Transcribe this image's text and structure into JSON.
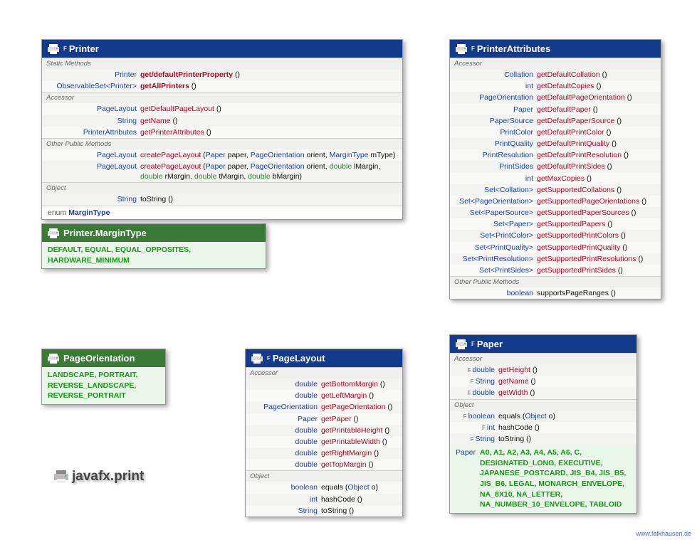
{
  "package": "javafx.print",
  "credit": "www.falkhausen.de",
  "printer": {
    "title": "Printer",
    "sup": "F",
    "sections": [
      {
        "label": "Static Methods",
        "rows": [
          {
            "ret": "Printer",
            "name": "get/defaultPrinterProperty",
            "bold": true,
            "sig": " ()"
          },
          {
            "ret": "ObservableSet<Printer>",
            "name": "getAllPrinters",
            "bold": true,
            "sig": " ()"
          }
        ]
      },
      {
        "label": "Accessor",
        "rows": [
          {
            "ret": "PageLayout",
            "name": "getDefaultPageLayout",
            "sig": " ()"
          },
          {
            "ret": "String",
            "name": "getName",
            "sig": " ()"
          },
          {
            "ret": "PrinterAttributes",
            "name": "getPrinterAttributes",
            "sig": " ()"
          }
        ]
      },
      {
        "label": "Other Public Methods",
        "rows": [
          {
            "ret": "PageLayout",
            "name": "createPageLayout",
            "sigHtml": " (<span class='t'>Paper</span> paper, <span class='t'>PageOrientation</span> orient, <span class='t'>MarginType</span> mType)"
          },
          {
            "ret": "PageLayout",
            "name": "createPageLayout",
            "sigHtml": " (<span class='t'>Paper</span> paper, <span class='t'>PageOrientation</span> orient, <span class='k'>double</span> lMargin,<br><span class='k'>double</span> rMargin, <span class='k'>double</span> tMargin, <span class='k'>double</span> bMargin)"
          }
        ]
      },
      {
        "label": "Object",
        "rows": [
          {
            "ret": "String",
            "name": "toString",
            "black": true,
            "sig": " ()"
          }
        ]
      }
    ],
    "enumFooter": {
      "kw": "enum",
      "name": "MarginType"
    }
  },
  "marginType": {
    "title": "Printer.MarginType",
    "values": "DEFAULT, EQUAL, EQUAL_OPPOSITES, HARDWARE_MINIMUM"
  },
  "printerAttr": {
    "title": "PrinterAttributes",
    "sup": "F",
    "sections": [
      {
        "label": "Accessor",
        "rows": [
          {
            "ret": "Collation",
            "name": "getDefaultCollation",
            "sig": " ()"
          },
          {
            "ret": "int",
            "name": "getDefaultCopies",
            "sig": " ()"
          },
          {
            "ret": "PageOrientation",
            "name": "getDefaultPageOrientation",
            "sig": " ()"
          },
          {
            "ret": "Paper",
            "name": "getDefaultPaper",
            "sig": " ()"
          },
          {
            "ret": "PaperSource",
            "name": "getDefaultPaperSource",
            "sig": " ()"
          },
          {
            "ret": "PrintColor",
            "name": "getDefaultPrintColor",
            "sig": " ()"
          },
          {
            "ret": "PrintQuality",
            "name": "getDefaultPrintQuality",
            "sig": " ()"
          },
          {
            "ret": "PrintResolution",
            "name": "getDefaultPrintResolution",
            "sig": " ()"
          },
          {
            "ret": "PrintSides",
            "name": "getDefaultPrintSides",
            "sig": " ()"
          },
          {
            "ret": "int",
            "name": "getMaxCopies",
            "sig": " ()"
          },
          {
            "ret": "Set<Collation>",
            "name": "getSupportedCollations",
            "sig": " ()"
          },
          {
            "ret": "Set<PageOrientation>",
            "name": "getSupportedPageOrientations",
            "sig": " ()"
          },
          {
            "ret": "Set<PaperSource>",
            "name": "getSupportedPaperSources",
            "sig": " ()"
          },
          {
            "ret": "Set<Paper>",
            "name": "getSupportedPapers",
            "sig": " ()"
          },
          {
            "ret": "Set<PrintColor>",
            "name": "getSupportedPrintColors",
            "sig": " ()"
          },
          {
            "ret": "Set<PrintQuality>",
            "name": "getSupportedPrintQuality",
            "sig": " ()"
          },
          {
            "ret": "Set<PrintResolution>",
            "name": "getSupportedPrintResolutions",
            "sig": " ()"
          },
          {
            "ret": "Set<PrintSides>",
            "name": "getSupportedPrintSides",
            "sig": " ()"
          }
        ]
      },
      {
        "label": "Other Public Methods",
        "rows": [
          {
            "ret": "boolean",
            "name": "supportsPageRanges",
            "black": true,
            "sig": " ()"
          }
        ]
      }
    ]
  },
  "pageOrientation": {
    "title": "PageOrientation",
    "values": "LANDSCAPE, PORTRAIT, REVERSE_LANDSCAPE, REVERSE_PORTRAIT"
  },
  "pageLayout": {
    "title": "PageLayout",
    "sup": "F",
    "sections": [
      {
        "label": "Accessor",
        "rows": [
          {
            "ret": "double",
            "name": "getBottomMargin",
            "sig": " ()"
          },
          {
            "ret": "double",
            "name": "getLeftMargin",
            "sig": " ()"
          },
          {
            "ret": "PageOrientation",
            "name": "getPageOrientation",
            "sig": " ()"
          },
          {
            "ret": "Paper",
            "name": "getPaper",
            "sig": " ()"
          },
          {
            "ret": "double",
            "name": "getPrintableHeight",
            "sig": " ()"
          },
          {
            "ret": "double",
            "name": "getPrintableWidth",
            "sig": " ()"
          },
          {
            "ret": "double",
            "name": "getRightMargin",
            "sig": " ()"
          },
          {
            "ret": "double",
            "name": "getTopMargin",
            "sig": " ()"
          }
        ]
      },
      {
        "label": "Object",
        "rows": [
          {
            "ret": "boolean",
            "name": "equals",
            "black": true,
            "sigHtml": " (<span class='t'>Object</span> o)"
          },
          {
            "ret": "int",
            "name": "hashCode",
            "black": true,
            "sig": " ()"
          },
          {
            "ret": "String",
            "name": "toString",
            "black": true,
            "sig": " ()"
          }
        ]
      }
    ]
  },
  "paper": {
    "title": "Paper",
    "sup": "F",
    "sections": [
      {
        "label": "Accessor",
        "rows": [
          {
            "mod": "F",
            "ret": "double",
            "name": "getHeight",
            "sig": " ()"
          },
          {
            "mod": "F",
            "ret": "String",
            "name": "getName",
            "sig": " ()"
          },
          {
            "mod": "F",
            "ret": "double",
            "name": "getWidth",
            "sig": " ()"
          }
        ]
      },
      {
        "label": "Object",
        "rows": [
          {
            "mod": "F",
            "ret": "boolean",
            "name": "equals",
            "black": true,
            "sigHtml": " (<span class='t'>Object</span> o)"
          },
          {
            "mod": "F",
            "ret": "int",
            "name": "hashCode",
            "black": true,
            "sig": " ()"
          },
          {
            "mod": "F",
            "ret": "String",
            "name": "toString",
            "black": true,
            "sig": " ()"
          }
        ]
      }
    ],
    "constLabel": "Paper",
    "constants": "A0, A1, A2, A3, A4, A5, A6, C, DESIGNATED_LONG, EXECUTIVE, JAPANESE_POSTCARD, JIS_B4, JIS_B5, JIS_B6, LEGAL, MONARCH_ENVELOPE, NA_8X10, NA_LETTER, NA_NUMBER_10_ENVELOPE, TABLOID"
  }
}
